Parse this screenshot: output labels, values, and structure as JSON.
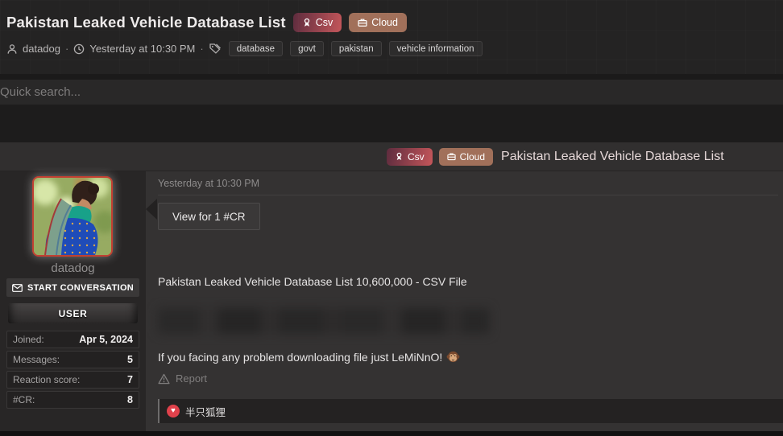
{
  "header": {
    "title": "Pakistan Leaked Vehicle Database List",
    "csv_badge": "Csv",
    "cloud_badge": "Cloud",
    "author": "datadog",
    "dot": "·",
    "timestamp": "Yesterday at 10:30 PM",
    "tags": [
      "database",
      "govt",
      "pakistan",
      "vehicle information"
    ]
  },
  "search": {
    "placeholder": "Quick search..."
  },
  "thread": {
    "csv_badge": "Csv",
    "cloud_badge": "Cloud",
    "title": "Pakistan Leaked Vehicle Database List"
  },
  "sidebar": {
    "username": "datadog",
    "start_conversation": "START CONVERSATION",
    "role": "USER",
    "stats": [
      {
        "label": "Joined:",
        "value": "Apr 5, 2024"
      },
      {
        "label": "Messages:",
        "value": "5"
      },
      {
        "label": "Reaction score:",
        "value": "7"
      },
      {
        "label": "#CR:",
        "value": "8"
      }
    ]
  },
  "post": {
    "timestamp": "Yesterday at 10:30 PM",
    "view_button": "View for 1 #CR",
    "body_line": "Pakistan Leaked Vehicle Database List 10,600,000 - CSV File",
    "help_line": "If you facing any problem downloading file just LeMiNnO!",
    "report": "Report",
    "reaction_heart": "♥",
    "reaction_names": "半只狐狸"
  },
  "colors": {
    "csv_gradient_start": "#5e2c3e",
    "csv_gradient_end": "#c4565a",
    "cloud_badge_bg": "#a1705a",
    "heart_reaction_bg": "#e0414b",
    "avatar_border": "#c24032"
  }
}
